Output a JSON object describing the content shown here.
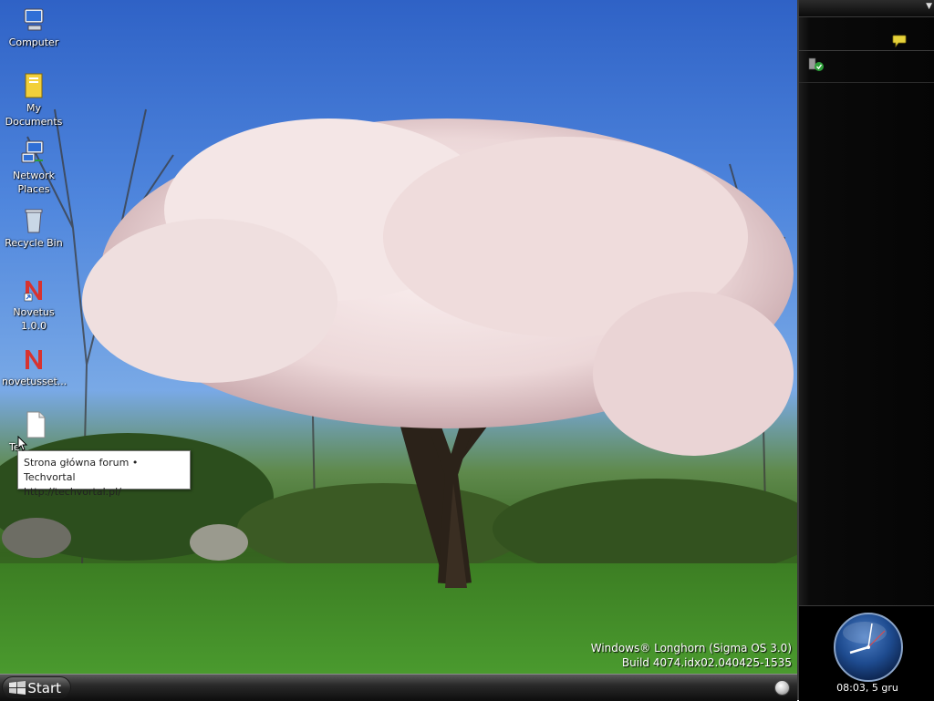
{
  "desktop": {
    "icons": [
      {
        "label": "Computer"
      },
      {
        "label": "My Documents"
      },
      {
        "label": "Network Places"
      },
      {
        "label": "Recycle Bin"
      },
      {
        "label": "Novetus 1.0.0"
      },
      {
        "label": "novetusset..."
      },
      {
        "label": "Te"
      }
    ],
    "tooltip": {
      "line1": "Strona główna forum • Techvortal",
      "line2": "http://techvortal.pl/"
    },
    "watermark": {
      "line1": "Windows® Longhorn (Sigma OS 3.0)",
      "line2": "Build 4074.idx02.040425-1535"
    }
  },
  "taskbar": {
    "start_label": "Start"
  },
  "sidebar": {
    "clock_text": "08:03, 5 gru"
  },
  "colors": {
    "sky": "#4f86dd",
    "grass": "#3f8a2a",
    "sidebar": "#050505"
  }
}
